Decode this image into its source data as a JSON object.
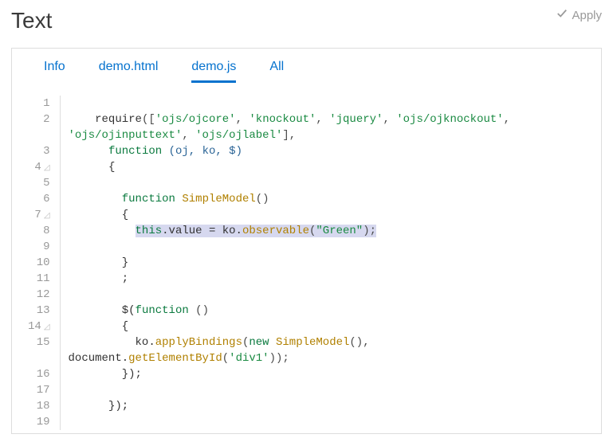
{
  "header": {
    "title": "Text",
    "apply_label": "Apply"
  },
  "tabs": [
    {
      "label": "Info",
      "active": false
    },
    {
      "label": "demo.html",
      "active": false
    },
    {
      "label": "demo.js",
      "active": true
    },
    {
      "label": "All",
      "active": false
    }
  ],
  "editor": {
    "line_numbers": [
      "1",
      "2",
      "3",
      "4",
      "5",
      "6",
      "7",
      "8",
      "9",
      "10",
      "11",
      "12",
      "13",
      "14",
      "15",
      "16",
      "17",
      "18",
      "19"
    ],
    "fold_lines": [
      4,
      7,
      14
    ],
    "highlighted_line": 8,
    "code": {
      "l1": "",
      "l2a": "    require",
      "l2b": "([",
      "l2c": "'ojs/ojcore'",
      "l2d": ", ",
      "l2e": "'knockout'",
      "l2f": ", ",
      "l2g": "'jquery'",
      "l2h": ", ",
      "l2i": "'ojs/ojknockout'",
      "l2j": ", ",
      "l2k": "'ojs/ojinputtext'",
      "l2l": ", ",
      "l2m": "'ojs/ojlabel'",
      "l2n": "],",
      "l3a": "      ",
      "l3b": "function ",
      "l3c": "(oj, ko, $)",
      "l4": "      {",
      "l5": "",
      "l6a": "        ",
      "l6b": "function ",
      "l6c": "SimpleModel",
      "l6d": "()",
      "l7": "        {",
      "l8a": "          ",
      "l8b": "this",
      "l8c": ".value = ko.",
      "l8d": "observable",
      "l8e": "(",
      "l8f": "\"Green\"",
      "l8g": ");",
      "l9": "",
      "l10": "        }",
      "l11": "        ;",
      "l12": "",
      "l13a": "        $(",
      "l13b": "function ",
      "l13c": "()",
      "l14": "        {",
      "l15a": "          ko.",
      "l15b": "applyBindings",
      "l15c": "(",
      "l15d": "new ",
      "l15e": "SimpleModel",
      "l15f": "(), ",
      "l15g": "document.",
      "l15h": "getElementById",
      "l15i": "(",
      "l15j": "'div1'",
      "l15k": "));",
      "l16": "        });",
      "l17": "",
      "l18": "      });",
      "l19": ""
    }
  }
}
